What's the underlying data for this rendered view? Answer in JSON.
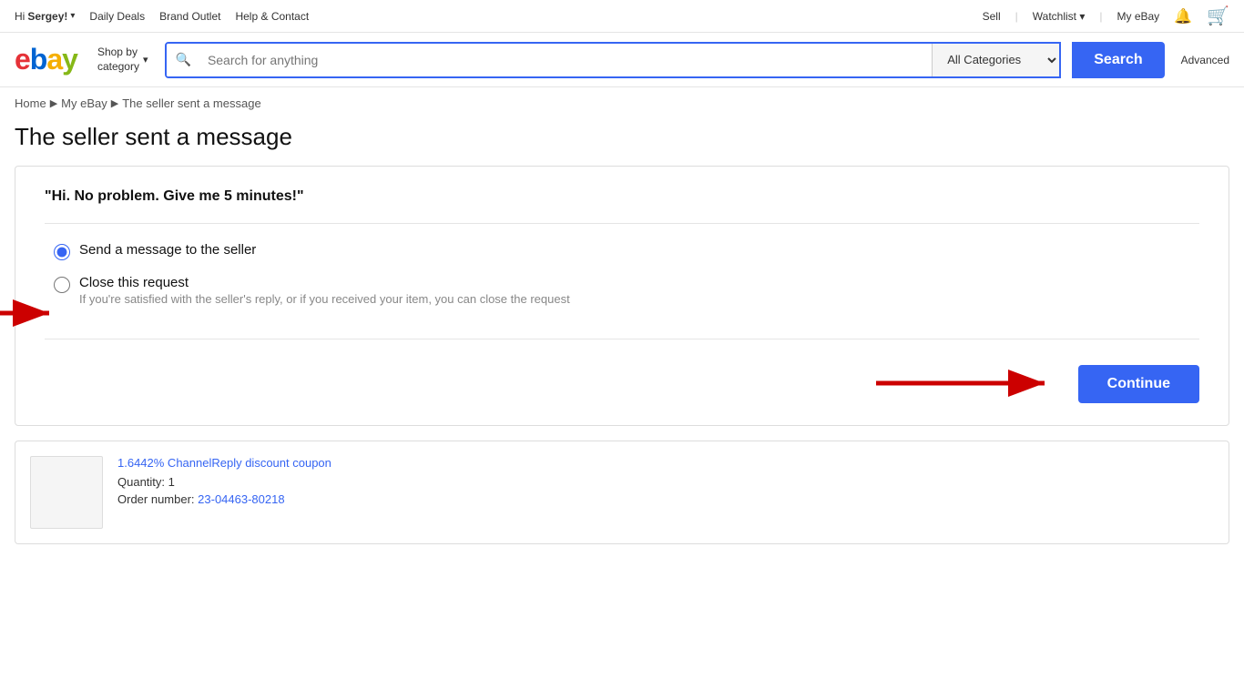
{
  "topNav": {
    "greeting": "Hi ",
    "username": "Sergey!",
    "links": [
      "Daily Deals",
      "Brand Outlet",
      "Help & Contact"
    ],
    "rightLinks": [
      "Sell",
      "Watchlist",
      "My eBay"
    ]
  },
  "header": {
    "shopByCategory": "Shop by\ncategory",
    "searchPlaceholder": "Search for anything",
    "categoryDefault": "All Categories",
    "searchButton": "Search",
    "advancedLink": "Advanced"
  },
  "breadcrumb": {
    "home": "Home",
    "myEbay": "My eBay",
    "current": "The seller sent a message"
  },
  "pageTitle": "The seller sent a message",
  "card": {
    "sellerMessage": "\"Hi. No problem. Give me 5 minutes!\"",
    "options": [
      {
        "id": "send-message",
        "label": "Send a message to the seller",
        "description": "",
        "checked": true
      },
      {
        "id": "close-request",
        "label": "Close this request",
        "description": "If you're satisfied with the seller's reply, or if you received your item, you can close the request",
        "checked": false
      }
    ],
    "continueButton": "Continue"
  },
  "orderCard": {
    "couponText": "1.6442% ChannelReply discount coupon",
    "quantity": "Quantity: 1",
    "orderLabel": "Order number: ",
    "orderNumber": "23-04463-80218"
  }
}
